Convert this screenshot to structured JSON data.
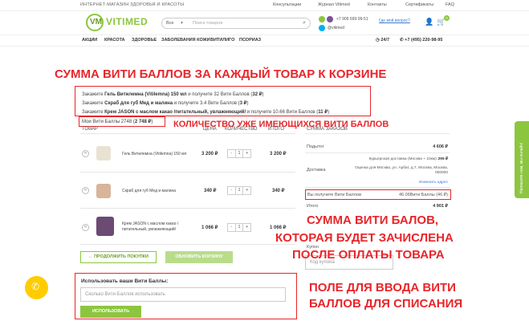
{
  "topbar": {
    "tagline": "ИНТЕРНЕТ-МАГАЗИН ЗДОРОВЬЯ И КРАСОТЫ",
    "links": [
      "Консультации",
      "Журнал Vitimed",
      "Контакты",
      "Сертификаты",
      "FAQ"
    ]
  },
  "header": {
    "logo_mark": "VM",
    "logo_text": "VITIMED",
    "search_category": "Все",
    "search_placeholder": "Поиск товаров",
    "phone1": "+7 909 699-99-51",
    "ask_question": "Где мой вопрос?",
    "skype": "@vitimed",
    "cart_count": "0",
    "hours": "24/7",
    "phone2": "+7 (495) 220-98-95"
  },
  "nav": [
    "АКЦИИ",
    "КРАСОТА",
    "ЗДОРОВЬЕ",
    "ЗАБОЛЕВАНИЯ КОЖИ",
    "ВИТИЛИГО",
    "ПСОРИАЗ"
  ],
  "annotations": {
    "top": "СУММА ВИТИ БАЛЛОВ ЗА КАЖДЫЙ ТОВАР К КОРЗИНЕ",
    "balance": "КОЛИЧЕСТВО УЖЕ ИМЕЮЩИХСЯ ВИТИ БАЛЛОВ",
    "credited_1": "СУММА ВИТИ БАЛОВ,",
    "credited_2": "КОТОРАЯ БУДЕТ ЗАЧИСЛЕНА",
    "credited_3": "ПОСЛЕ ОПЛАТЫ ТОВАРА",
    "input_1": "ПОЛЕ ДЛЯ ВВОДА ВИТИ",
    "input_2": "БАЛЛОВ ДЛЯ СПИСАНИЯ"
  },
  "offers": [
    {
      "pre": "Закажите ",
      "name": "Гель Витилемна (Vitilemna) 150 мл",
      "mid": " и получите 32 Вити Баллов (",
      "pts": "32 ₽",
      "post": ")"
    },
    {
      "pre": "Закажите ",
      "name": "Скраб для губ Мед и малина",
      "mid": " и получите 3.4 Вити Баллов (",
      "pts": "3 ₽",
      "post": ")"
    },
    {
      "pre": "Закажите ",
      "name": "Крем JASON с маслом какао /питательный, увлажняющий/",
      "mid": " и получите 10.66 Вити Баллов (",
      "pts": "11 ₽",
      "post": ")"
    }
  ],
  "balance": {
    "label": "Мои Вити Баллы 2748 (",
    "value": "2 748 ₽",
    "close": ")"
  },
  "table": {
    "headers": [
      "ТОВАР",
      "ЦЕНА",
      "КОЛИЧЕСТВО",
      "ИТОГО"
    ],
    "rows": [
      {
        "name": "Гель Витилемна (Vitilemna) 150 мл",
        "price": "3 200 ₽",
        "qty": "1",
        "total": "3 200 ₽"
      },
      {
        "name": "Скраб для губ Мед и малина",
        "price": "340 ₽",
        "qty": "1",
        "total": "340 ₽"
      },
      {
        "name": "Крем JASON с маслом какао / питательный, увлажняющий/",
        "price": "1 066 ₽",
        "qty": "1",
        "total": "1 066 ₽"
      }
    ]
  },
  "buttons": {
    "continue": "← ПРОДОЛЖИТЬ ПОКУПКИ",
    "update": "ОБНОВИТЬ КОРЗИНУ",
    "apply": "ИСПОЛЬЗОВАТЬ"
  },
  "summary": {
    "title": "СУММА ЗАКАЗОВ",
    "subtotal_label": "Подытог",
    "subtotal": "4 606 ₽",
    "delivery_label": "Доставка",
    "courier": "Курьерская доставка (Москва + 10км):",
    "courier_price": "295 ₽",
    "estimate": "Оценка для Москва, ул. Арбат, д.7, Москва, Москва, 000000",
    "change_address": "Изменить адрес",
    "receive_label": "Вы получите Вити Баллов",
    "receive_value": "46.06Вити Баллы (46 ₽)",
    "total_label": "Итого",
    "total": "4 901 ₽",
    "coupon_label": "Купон",
    "coupon_placeholder": "Код купона"
  },
  "points_form": {
    "label": "Использовать ваши Вити Баллы:",
    "placeholder": "Сколько Вити Баллов использовать"
  },
  "side_tab": "Напишите нам, мы онлайн!"
}
